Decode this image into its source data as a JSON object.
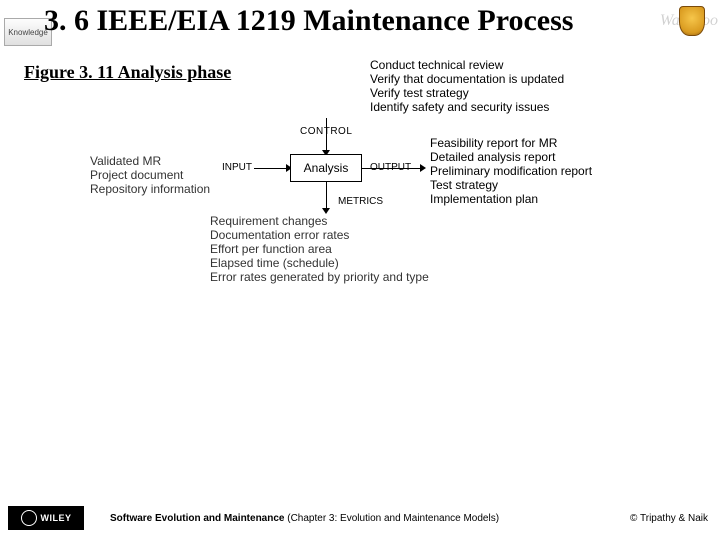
{
  "header": {
    "title": "3. 6 IEEE/EIA 1219 Maintenance Process",
    "logo_left_label": "Knowledge",
    "watermark": "Waterloo"
  },
  "subtitle": "Figure 3. 11 Analysis phase",
  "diagram": {
    "box_label": "Analysis",
    "control_label": "CONTROL",
    "input_label": "INPUT",
    "output_label": "OUTPUT",
    "metrics_label": "METRICS",
    "control_items": [
      "Conduct technical review",
      "Verify that documentation is updated",
      "Verify test strategy",
      "Identify safety and security issues"
    ],
    "input_items": [
      "Validated MR",
      "Project document",
      "Repository information"
    ],
    "output_items": [
      "Feasibility report for MR",
      "Detailed analysis report",
      "Preliminary modification report",
      "Test strategy",
      "Implementation plan"
    ],
    "metrics_items": [
      "Requirement changes",
      "Documentation error rates",
      "Effort per function area",
      "Elapsed time (schedule)",
      "Error rates generated by priority and type"
    ]
  },
  "footer": {
    "wiley": "WILEY",
    "center_bold": "Software Evolution and Maintenance",
    "center_rest": " (Chapter 3: Evolution and Maintenance Models)",
    "right": "© Tripathy & Naik"
  }
}
